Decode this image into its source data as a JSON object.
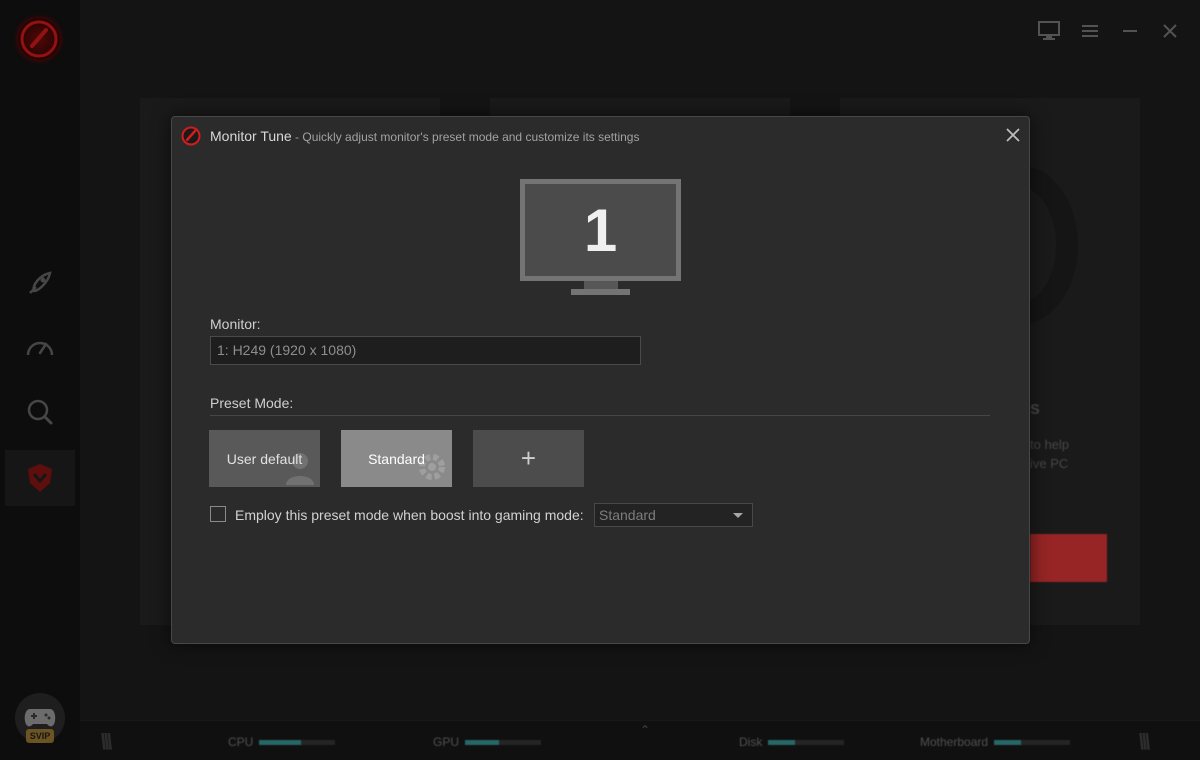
{
  "window": {
    "controls": [
      "display-settings",
      "menu",
      "minimize",
      "close"
    ]
  },
  "sidebar": {
    "items": [
      {
        "icon": "rocket-icon"
      },
      {
        "icon": "speedometer-icon"
      },
      {
        "icon": "scan-icon"
      },
      {
        "icon": "shield-icon",
        "active": true
      }
    ],
    "badge": "SVIP"
  },
  "background": {
    "text_lines": [
      "s",
      "to help",
      "ive PC"
    ]
  },
  "statusbar": {
    "items": [
      {
        "label": "CPU",
        "level": 0.55
      },
      {
        "label": "GPU",
        "level": 0.45
      },
      {
        "label": "Disk",
        "level": 0.35
      },
      {
        "label": "Motherboard",
        "level": 0.35
      }
    ]
  },
  "dialog": {
    "title": "Monitor Tune",
    "subtitle": " - Quickly adjust monitor's preset mode and customize its settings",
    "monitor_number": "1",
    "monitor_label": "Monitor:",
    "monitor_value": "1: H249 (1920 x 1080)",
    "preset_label": "Preset Mode:",
    "presets": [
      {
        "label": "User default",
        "selected": false
      },
      {
        "label": "Standard",
        "selected": true
      }
    ],
    "add_label": "+",
    "gaming_checkbox_label": "Employ this preset mode when boost into gaming mode:",
    "gaming_checked": false,
    "gaming_select_value": "Standard"
  },
  "colors": {
    "accent": "#e83a3a",
    "status_fill": "#3c9e9e",
    "svip": "#c5973a"
  }
}
